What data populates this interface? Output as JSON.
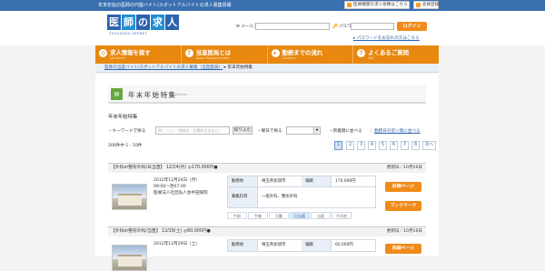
{
  "topbar": {
    "tagline": "年末年始の医師の円盤バイト/スポットアルバイトの求人募集情報",
    "hospital_register": "医療機関の求人依頼はこちら",
    "member_register": "会員登録"
  },
  "logo": {
    "text": [
      "医",
      "師",
      "の",
      "求",
      "人"
    ],
    "sub": "TOUCHOKU  SKYNET"
  },
  "login": {
    "mail_label": "メールアドレス",
    "password_label": "パスワード",
    "button": "ログイン",
    "forgot": "パスワードをお忘れの方はこちら"
  },
  "nav": [
    {
      "icon": "◎",
      "label": "求人情報を探す",
      "sub": "Job Search"
    },
    {
      "icon": "?",
      "label": "当直医局とは",
      "sub": "About Touchoku Ikyoku"
    },
    {
      "icon": "▸",
      "label": "勤務までの流れ",
      "sub": "Guidance"
    },
    {
      "icon": "?",
      "label": "よくあるご質問",
      "sub": "FAQ"
    }
  ],
  "breadcrumb": {
    "items": [
      "医師の当直バイト/スポットアルバイトの求人募集（当直医局）"
    ],
    "current": "年末年始特集"
  },
  "page": {
    "title": "年末年始特集",
    "title_sub": "feature",
    "section": "年末年始特集",
    "keyword_label": "キーワードで探る",
    "keyword_placeholder": "例）○○○（地域名、診療科目名など）",
    "search_button": "絞り込む",
    "day_label": "曜日で探る",
    "sort_label": "新着順に並べる",
    "sort_link": "勤務日の近い順に並べる",
    "count_text": "206件中 1 - 10件",
    "pages": [
      "1",
      "2",
      "3",
      "4",
      "5",
      "6",
      "7",
      "8"
    ],
    "current_page": "1",
    "next": "次へ"
  },
  "jobs": [
    {
      "header": "【外科or整形外科/日当直】 12/24(月) ◎170,000円●",
      "updated": "更新日／10月16日",
      "date": "2012年12月24日（月）",
      "time": "09:00～翌07:00",
      "org": "医療法人社団弘人会中田病院",
      "area_label": "勤務地",
      "area": "埼玉県加須市",
      "pay_label": "報酬",
      "pay": "170,000円",
      "dept_label": "募集科目",
      "dept": "一般外科、整形外科",
      "shifts": [
        "午前",
        "午後",
        "日勤",
        "日当直",
        "当直",
        "その他"
      ],
      "active_shift": "日当直",
      "detail_btn": "詳細ページ",
      "bookmark_btn": "ブックマーク"
    },
    {
      "header": "【外科or整形外科/当直】 12/29(土) ◎60,000円●",
      "updated": "更新日／10月16日",
      "date": "2012年12月29日（土）",
      "area_label": "勤務地",
      "area": "埼玉県加須市",
      "pay_label": "報酬",
      "pay": "60,000円",
      "detail_btn": "詳細ページ"
    }
  ]
}
